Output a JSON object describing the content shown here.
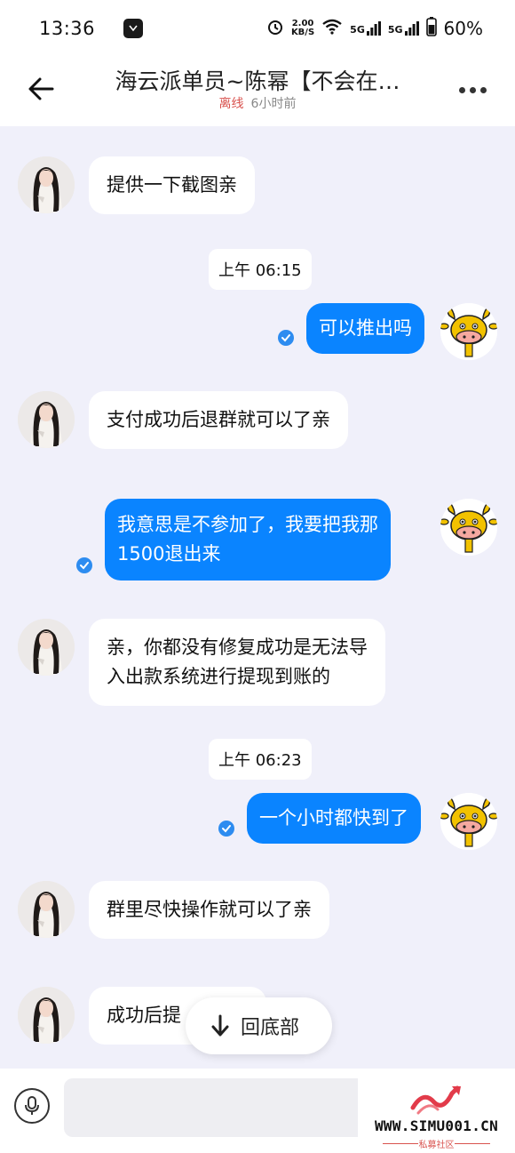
{
  "status_bar": {
    "time": "13:36",
    "net_speed_value": "2.00",
    "net_speed_unit": "KB/S",
    "signal1": "5G",
    "signal2": "5G",
    "battery": "60%"
  },
  "header": {
    "title": "海云派单员~陈幂【不会在…",
    "status_offline": "离线",
    "last_seen": "6小时前"
  },
  "messages": [
    {
      "from": "them",
      "text": "提供一下截图亲"
    },
    {
      "type": "time",
      "text": "上午 06:15"
    },
    {
      "from": "me",
      "text": "可以推出吗"
    },
    {
      "from": "them",
      "text": "支付成功后退群就可以了亲"
    },
    {
      "from": "me",
      "line1": "我意思是不参加了，我要把我那",
      "line2": "1500退出来"
    },
    {
      "from": "them",
      "line1": "亲，你都没有修复成功是无法导",
      "line2": "入出款系统进行提现到账的"
    },
    {
      "type": "time",
      "text": "上午 06:23"
    },
    {
      "from": "me",
      "text": "一个小时都快到了"
    },
    {
      "from": "them",
      "text": "群里尽快操作就可以了亲"
    },
    {
      "from": "them",
      "text": "成功后提"
    }
  ],
  "scroll_to_bottom_label": "回底部",
  "input": {
    "value": "",
    "placeholder": ""
  },
  "watermark": {
    "url": "WWW.SIMU001.CN",
    "sub": "私募社区"
  },
  "colors": {
    "outgoing_bubble": "#0A84FF",
    "background": "#F0F0FA",
    "offline": "#D9534F"
  }
}
